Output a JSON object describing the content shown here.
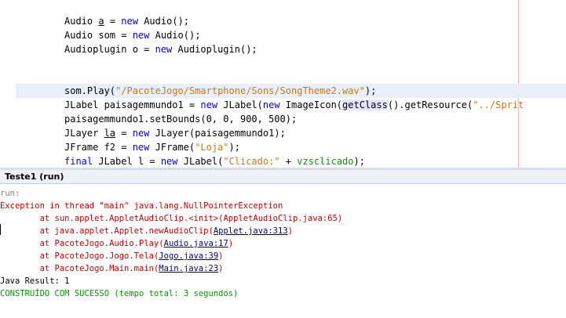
{
  "editor": {
    "lines": [
      {
        "p0": "Audio ",
        "p1": "a",
        "p2": " = ",
        "p3": "new",
        "p4": " Audio();"
      },
      {
        "p0": "Audio som = ",
        "p1": "new",
        "p2": " Audio();"
      },
      {
        "p0": "Audioplugin o = ",
        "p1": "new",
        "p2": " Audioplugin();"
      },
      {
        "p0": "som.Play(",
        "p1": "\"/PacoteJogo/Smartphone/Sons/SongTheme2.wav\"",
        "p2": ");"
      },
      {
        "p0": "JLabel paisagemmundo1 = ",
        "p1": "new",
        "p2": " JLabel(",
        "p3": "new",
        "p4": " ImageIcon(",
        "p5": "getClass",
        "p6": "().getResource(",
        "p7": "\"../Sprit"
      },
      {
        "p0": "paisagemmundo1.setBounds(0, 0, 900, 500);"
      },
      {
        "p0": "JLayer ",
        "p1": "la",
        "p2": " = ",
        "p3": "new",
        "p4": " JLayer(paisagemmundo1);"
      },
      {
        "p0": "JFrame f2 = ",
        "p1": "new",
        "p2": " JFrame(",
        "p3": "\"Loja\"",
        "p4": ");"
      },
      {
        "p0": "final",
        "p1": " JLabel l = ",
        "p2": "new",
        "p3": " JLabel(",
        "p4": "\"Clicado:\"",
        "p5": " + ",
        "p6": "vzsclicado",
        "p7": ");"
      }
    ]
  },
  "output_panel": {
    "tab_label": "Teste1 (run)",
    "lines": {
      "run": "run:",
      "exception": "Exception in thread \"main\" java.lang.NullPointerException",
      "st1": "        at sun.applet.AppletAudioClip.<init>(AppletAudioClip.java:65)",
      "st2_pre": "        at java.applet.Applet.newAudioClip(",
      "st2_link": "Applet.java:313",
      "st3_pre": "        at PacoteJogo.Audio.Play(",
      "st3_link": "Audio.java:17",
      "st4_pre": "        at PacoteJogo.Jogo.Tela(",
      "st4_link": "Jogo.java:39",
      "st5_pre": "        at PacoteJogo.Main.main(",
      "st5_link": "Main.java:23",
      "close": ")",
      "result": "Java Result: 1",
      "success": "CONSTRUÍDO COM SUCESSO (tempo total: 3 segundos)"
    }
  }
}
